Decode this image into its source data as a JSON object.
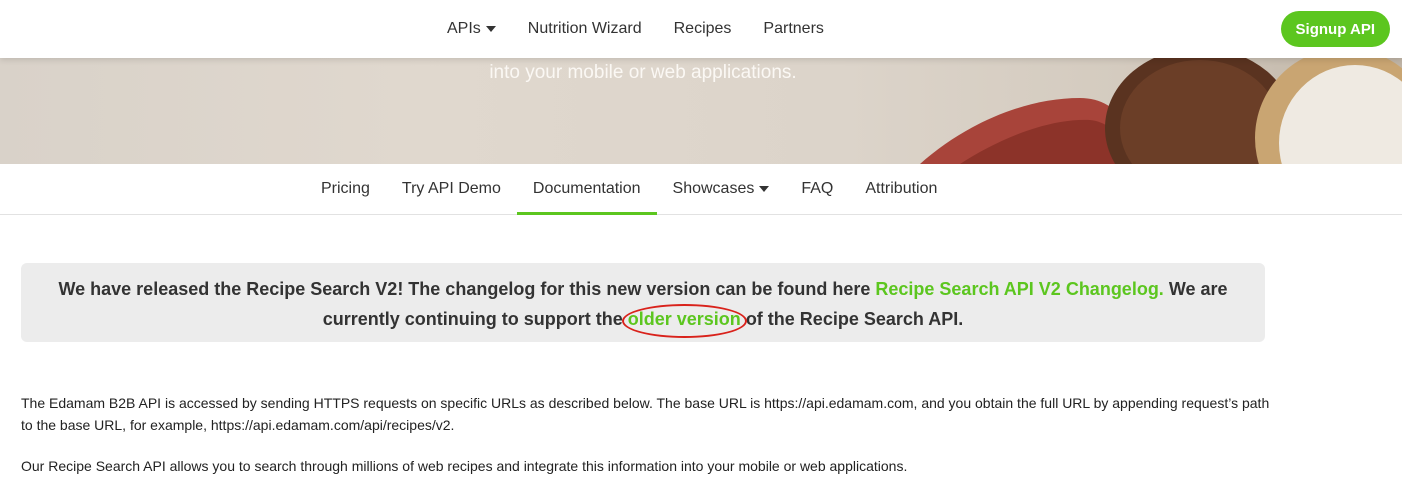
{
  "topnav": {
    "links": [
      "APIs",
      "Nutrition Wizard",
      "Recipes",
      "Partners"
    ],
    "signup_label": "Signup API"
  },
  "hero": {
    "tagline": "into your mobile or web applications."
  },
  "subnav": {
    "tabs": [
      "Pricing",
      "Try API Demo",
      "Documentation",
      "Showcases",
      "FAQ",
      "Attribution"
    ],
    "active": "Documentation"
  },
  "notice": {
    "part1": "We have released the Recipe Search V2! The changelog for this new version can be found here ",
    "link1": "Recipe Search API V2 Changelog.",
    "part2": " We are currently continuing to support the ",
    "link2": "older version",
    "part3": " of the Recipe Search API."
  },
  "content": {
    "para1": "The Edamam B2B API is accessed by sending HTTPS requests on specific URLs as described below. The base URL is https://api.edamam.com, and you obtain the full URL by appending request’s path to the base URL, for example, https://api.edamam.com/api/recipes/v2.",
    "para2": "Our Recipe Search API allows you to search through millions of web recipes and integrate this information into your mobile or web applications."
  },
  "colors": {
    "accent": "#5cc61f",
    "highlight_circle": "#d9221b",
    "notice_bg": "#ececec"
  }
}
